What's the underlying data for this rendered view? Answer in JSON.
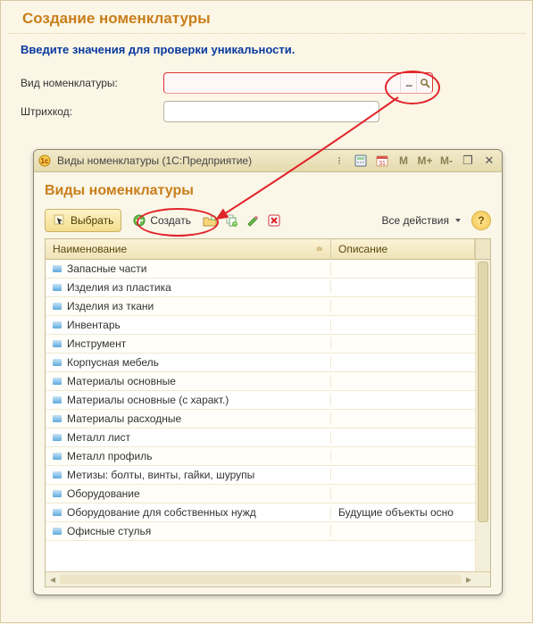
{
  "page": {
    "title": "Создание номенклатуры",
    "instruction": "Введите значения для проверки уникальности."
  },
  "form": {
    "nomenclature_type_label": "Вид номенклатуры:",
    "nomenclature_type_value": "",
    "barcode_label": "Штрихкод:",
    "barcode_value": ""
  },
  "dialog": {
    "window_title": "Виды номенклатуры  (1С:Предприятие)",
    "heading": "Виды номенклатуры",
    "toolbar": {
      "select": "Выбрать",
      "create": "Создать",
      "all_actions": "Все действия"
    },
    "columns": {
      "name": "Наименование",
      "desc": "Описание"
    },
    "rows": [
      {
        "name": "Запасные части",
        "desc": ""
      },
      {
        "name": "Изделия из пластика",
        "desc": ""
      },
      {
        "name": "Изделия из ткани",
        "desc": ""
      },
      {
        "name": "Инвентарь",
        "desc": ""
      },
      {
        "name": "Инструмент",
        "desc": ""
      },
      {
        "name": "Корпусная мебель",
        "desc": ""
      },
      {
        "name": "Материалы основные",
        "desc": ""
      },
      {
        "name": "Материалы основные (с характ.)",
        "desc": ""
      },
      {
        "name": "Материалы расходные",
        "desc": ""
      },
      {
        "name": "Металл лист",
        "desc": ""
      },
      {
        "name": "Металл профиль",
        "desc": ""
      },
      {
        "name": "Метизы: болты, винты, гайки, шурупы",
        "desc": ""
      },
      {
        "name": "Оборудование",
        "desc": ""
      },
      {
        "name": "Оборудование для собственных нужд",
        "desc": "Будущие объекты осно"
      },
      {
        "name": "Офисные стулья",
        "desc": ""
      }
    ],
    "titlebar_buttons": {
      "m": "M",
      "m_plus": "M+",
      "m_minus": "M-"
    }
  }
}
